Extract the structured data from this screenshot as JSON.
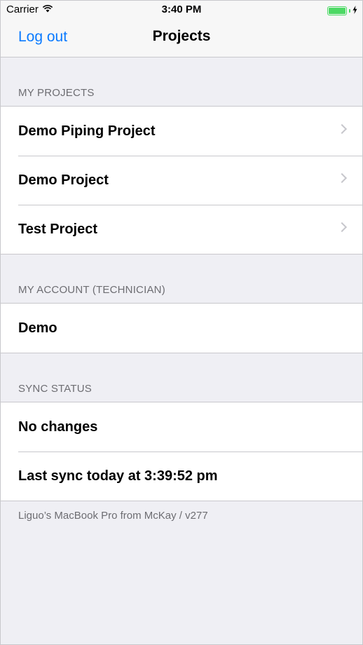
{
  "status_bar": {
    "carrier": "Carrier",
    "time": "3:40 PM",
    "battery_level": 1.0
  },
  "nav": {
    "back_label": "Log out",
    "title": "Projects"
  },
  "sections": {
    "projects": {
      "header": "MY PROJECTS",
      "items": [
        {
          "label": "Demo Piping Project"
        },
        {
          "label": "Demo Project"
        },
        {
          "label": "Test Project"
        }
      ]
    },
    "account": {
      "header": "MY ACCOUNT (TECHNICIAN)",
      "name": "Demo"
    },
    "sync": {
      "header": "SYNC STATUS",
      "changes": "No changes",
      "last_sync": "Last sync today at 3:39:52 pm"
    }
  },
  "footer": "Liguo’s MacBook Pro from McKay / v277",
  "colors": {
    "accent": "#0a7aff",
    "background": "#efeff4",
    "battery": "#4cd964"
  }
}
